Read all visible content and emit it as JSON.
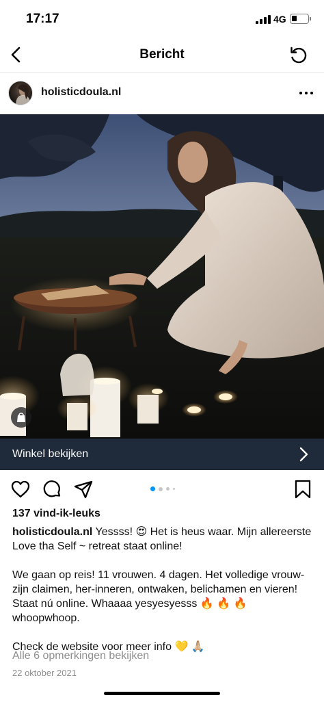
{
  "status_bar": {
    "time": "17:17",
    "network": "4G",
    "battery_level": 0.3
  },
  "nav": {
    "title": "Bericht",
    "back_icon": "chevron-left-icon",
    "refresh_icon": "refresh-icon"
  },
  "post": {
    "username": "holisticdoula.nl",
    "more_icon": "more-horizontal-icon",
    "shop_label": "Winkel bekijken",
    "carousel": {
      "count": 4,
      "active": 0
    },
    "likes": "137 vind-ik-leuks",
    "caption": {
      "username": "holisticdoula.nl",
      "line1": "Yessss! 😍 Het is heus waar. Mijn allereerste Love tha Self ~ retreat staat online!",
      "para2": "We gaan op reis! 11 vrouwen. 4 dagen. Het volledige vrouw-zijn claimen, her-inneren, ontwaken, belichamen en vieren! Staat nú online. Whaaaa yesyesyesss 🔥 🔥 🔥 whoopwhoop.",
      "para3": "Check de website voor meer info 💛 🙏🏼"
    },
    "comments_link": "Alle 6 opmerkingen bekijken",
    "date": "22 oktober 2021"
  },
  "colors": {
    "shop_bar": "#1f2a3a",
    "active_dot": "#0095f6",
    "muted_text": "#8e8e8e"
  }
}
